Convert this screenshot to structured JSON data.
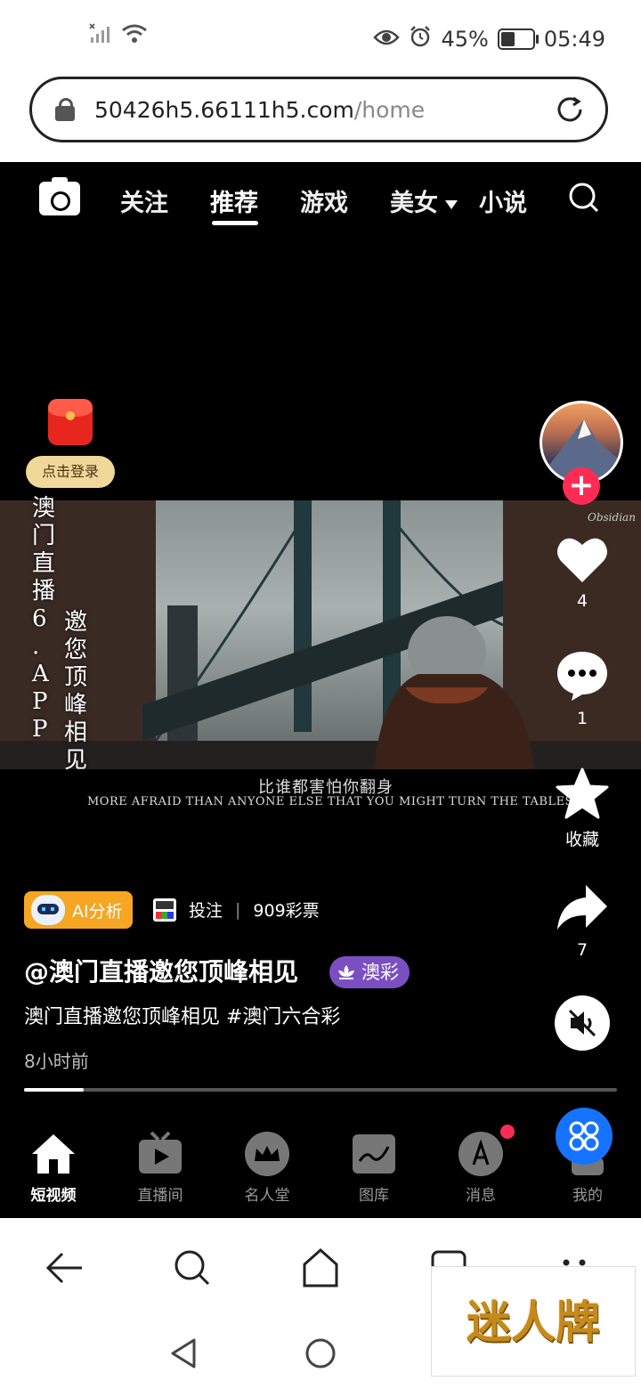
{
  "status_bar": {
    "battery": "45%",
    "battery_level": 0.45,
    "time": "05:49"
  },
  "browser": {
    "url_host": "50426h5.66111h5.com",
    "url_path": "/home"
  },
  "top_tabs": [
    "关注",
    "推荐",
    "游戏",
    "美女",
    "小说"
  ],
  "active_tab": "推荐",
  "left_float": {
    "login_label": "点击登录"
  },
  "video": {
    "overlay_text_1": "澳门直播6.APP",
    "overlay_text_2": "邀您顶峰相见",
    "subtitle_cn": "比谁都害怕你翻身",
    "subtitle_en": "MORE AFRAID THAN ANYONE ELSE THAT YOU MIGHT TURN THE TABLES.",
    "watermark_sig": "Obsidian",
    "progress": 0.1
  },
  "actions": {
    "likes": "4",
    "comments": "1",
    "favorite_label": "收藏",
    "shares": "7"
  },
  "ai_badge": {
    "label": "AI分析"
  },
  "lottery": {
    "bet_label": "投注",
    "name": "909彩票",
    "logo_text": "彩票909"
  },
  "post": {
    "author": "@澳门直播邀您顶峰相见",
    "tag": "澳彩",
    "caption": "澳门直播邀您顶峰相见 #澳门六合彩",
    "time": "8小时前"
  },
  "bottom_nav": [
    "短视频",
    "直播间",
    "名人堂",
    "图库",
    "消息",
    "我的"
  ],
  "overlay_watermark": "迷人牌",
  "colors": {
    "accent_red": "#fe2c55",
    "ai_orange": "#f6a623",
    "tag_purple": "#7b4fc2",
    "fab_blue": "#1673ff"
  }
}
